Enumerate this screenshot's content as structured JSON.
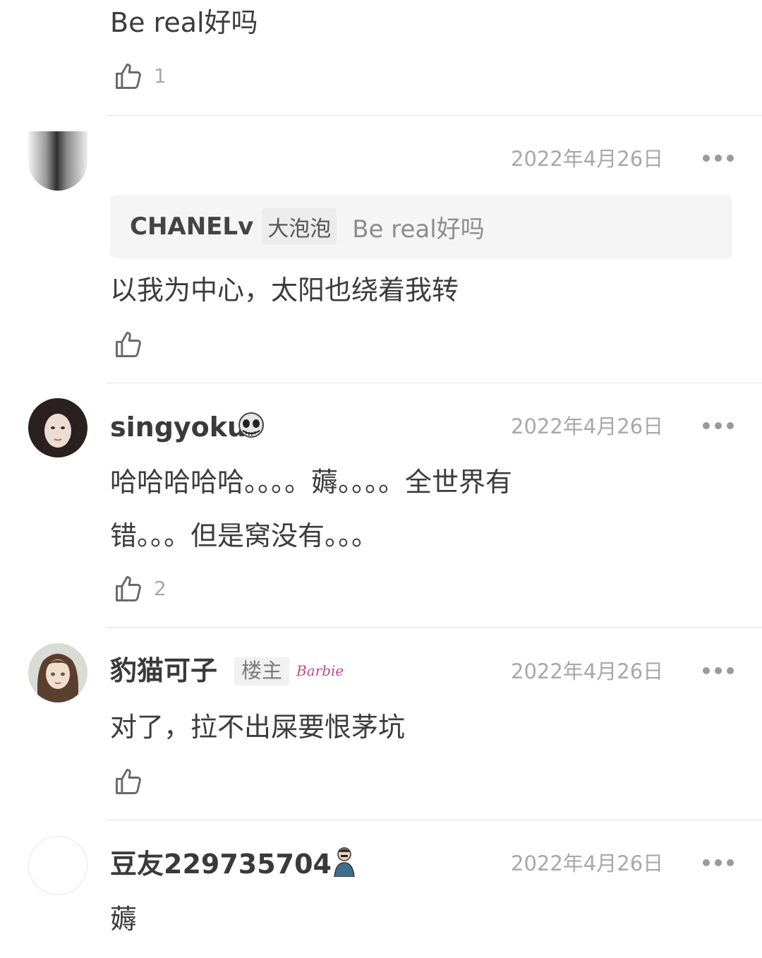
{
  "comments": [
    {
      "text": "Be real好吗",
      "likes": "1"
    },
    {
      "date": "2022年4月26日",
      "quote": {
        "user": "CHANELv",
        "badge": "大泡泡",
        "text": "Be real好吗"
      },
      "text": "以我为中心，太阳也绕着我转",
      "likes": ""
    },
    {
      "user": "singyoku",
      "user_emoji": "skull-icon",
      "date": "2022年4月26日",
      "text_line1": "哈哈哈哈哈。。。。薅。。。。全世界有",
      "text_line2": "错。。。但是窝没有。。。",
      "likes": "2"
    },
    {
      "user": "豹猫可子",
      "badge": "楼主",
      "sticker_text": "Barbie",
      "date": "2022年4月26日",
      "text": "对了，拉不出屎要恨茅坑",
      "likes": ""
    },
    {
      "user": "豆友229735704",
      "user_emoji": "man-figure-icon",
      "date": "2022年4月26日",
      "text": "薅"
    }
  ],
  "colors": {
    "text": "#3c3c3c",
    "muted": "#a8a8a8",
    "divider": "#e2e2e2",
    "quote_bg": "#f5f5f5"
  }
}
